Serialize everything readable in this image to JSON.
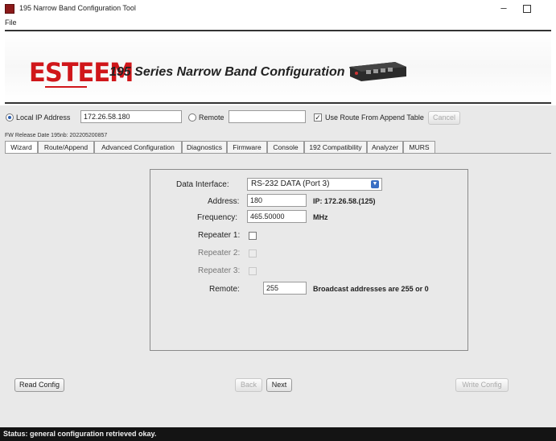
{
  "window": {
    "title": "195 Narrow Band Configuration Tool",
    "minimize": "–"
  },
  "menu": {
    "file": "File"
  },
  "banner": {
    "logo": "ESTEEM",
    "title": "195 Series Narrow Band Configuration Tool"
  },
  "connection": {
    "local_label": "Local IP Address",
    "local_ip": "172.26.58.180",
    "local_selected": true,
    "remote_label": "Remote",
    "remote_value": "",
    "use_route_label": "Use Route From Append Table",
    "use_route_checked": true,
    "cancel_label": "Cancel"
  },
  "fw_release": "FW Release Date 195nb: 202205200857",
  "tabs": [
    {
      "label": "Wizard",
      "active": true
    },
    {
      "label": "Route/Append"
    },
    {
      "label": "Advanced Configuration"
    },
    {
      "label": "Diagnostics"
    },
    {
      "label": "Firmware"
    },
    {
      "label": "Console"
    },
    {
      "label": "192 Compatibility"
    },
    {
      "label": "Analyzer"
    },
    {
      "label": "MURS"
    }
  ],
  "wizard": {
    "data_interface_label": "Data Interface:",
    "data_interface_value": "RS-232 DATA (Port 3)",
    "address_label": "Address:",
    "address_value": "180",
    "ip_info": "IP: 172.26.58.(125)",
    "frequency_label": "Frequency:",
    "frequency_value": "465.50000",
    "frequency_unit": "MHz",
    "repeater1_label": "Repeater 1:",
    "repeater2_label": "Repeater 2:",
    "repeater3_label": "Repeater 3:",
    "remote_label": "Remote:",
    "remote_value": "255",
    "broadcast_info": "Broadcast addresses are 255 or 0"
  },
  "buttons": {
    "read_config": "Read Config",
    "back": "Back",
    "next": "Next",
    "write_config": "Write Config"
  },
  "status": "Status: general configuration retrieved okay.",
  "colors": {
    "accent": "#d0161a",
    "statusbar": "#141414",
    "background": "#e9e9e9"
  },
  "icons": {
    "app": "app-icon",
    "dropdown": "chevron-down-icon",
    "check": "checkmark-icon"
  }
}
